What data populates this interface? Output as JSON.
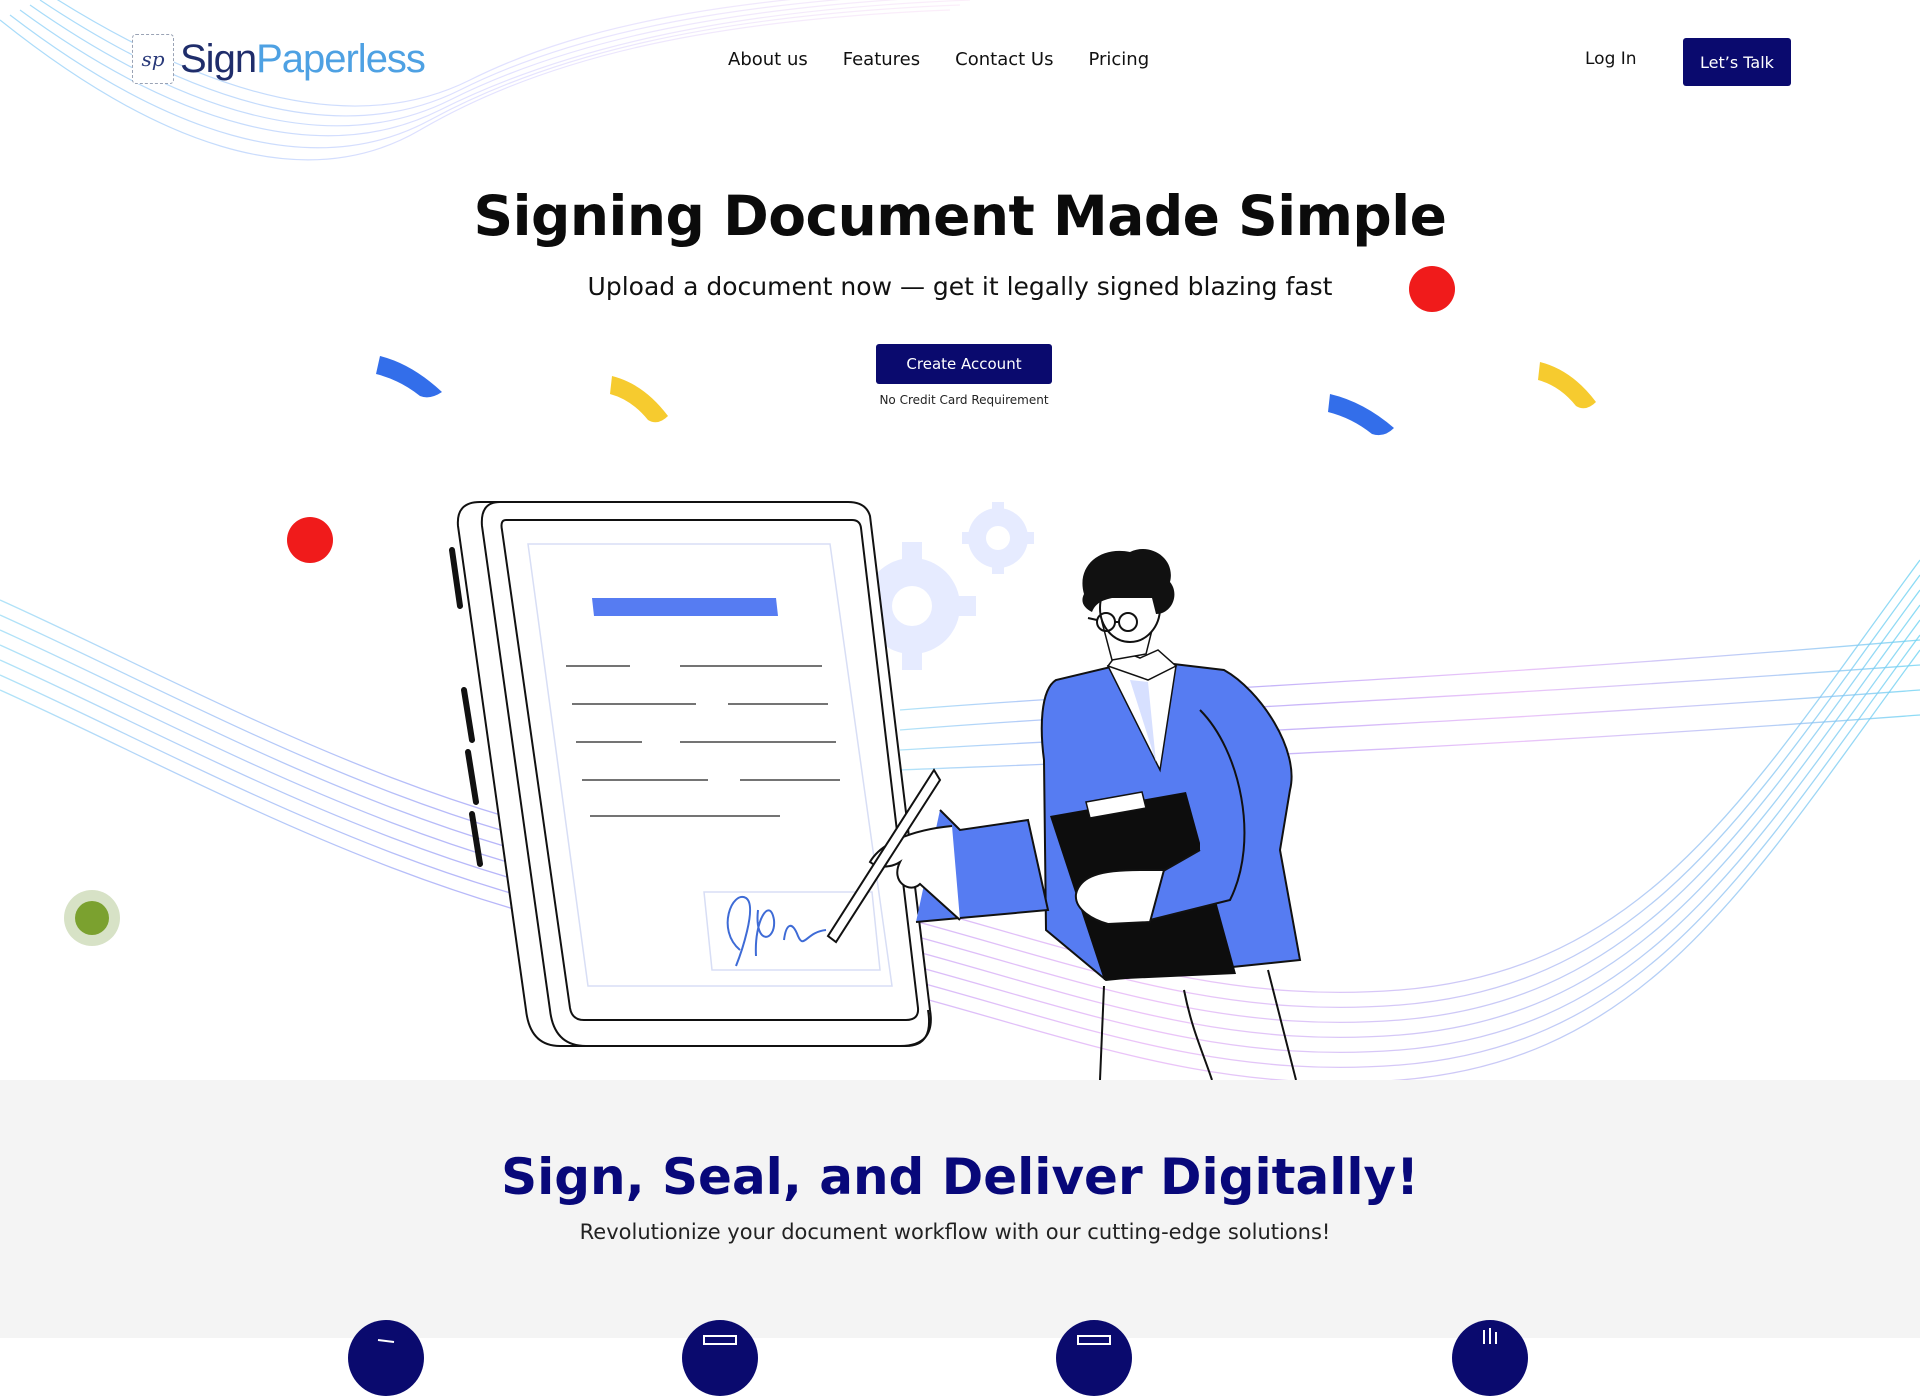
{
  "brand": {
    "logo_mark": "sp",
    "name_part1": "Sign",
    "name_part2": "Paperless"
  },
  "nav": {
    "links": [
      "About us",
      "Features",
      "Contact Us",
      "Pricing"
    ],
    "login": "Log In",
    "talk_button": "Let’s Talk"
  },
  "hero": {
    "title": "Signing Document Made Simple",
    "subtitle": "Upload a document now — get it legally signed blazing fast",
    "cta": "Create Account",
    "note": "No Credit Card Requirement"
  },
  "section2": {
    "title": "Sign, Seal, and Deliver Digitally!",
    "subtitle": "Revolutionize your document workflow with our cutting-edge solutions!",
    "feature_icons": [
      "send-icon",
      "laptop-icon",
      "monitor-icon",
      "chart-icon"
    ]
  },
  "colors": {
    "primary": "#0a0a6e",
    "accent_blue": "#567cf2",
    "logo_dark": "#1f2d6b",
    "logo_light": "#4ea1e3",
    "confetti_blue": "#1d5ee8",
    "confetti_yellow": "#f5c518",
    "confetti_red": "#f01b1b",
    "chat_green": "#7ba12f",
    "section_bg": "#f4f4f4"
  }
}
